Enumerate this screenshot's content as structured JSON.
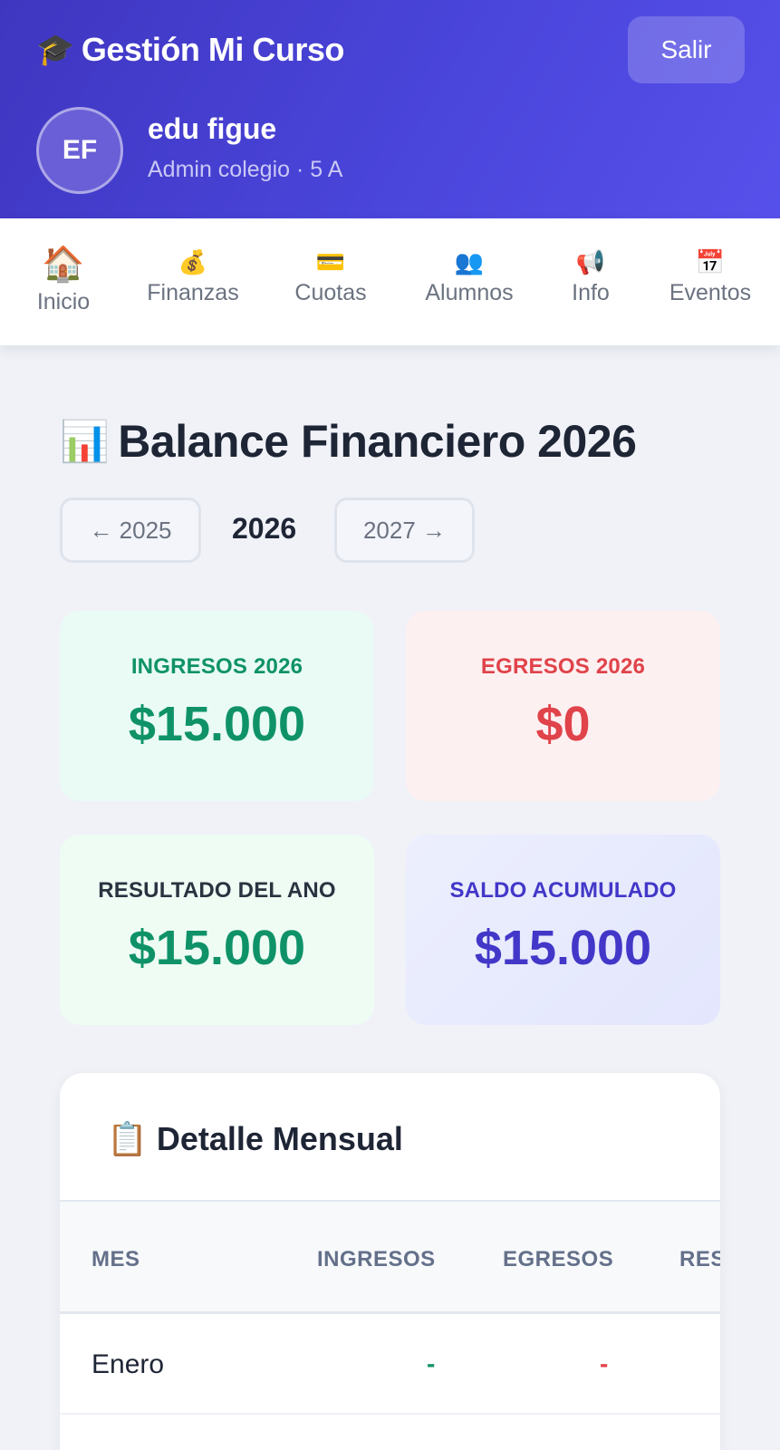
{
  "header": {
    "brand_icon": "graduation-cap-icon",
    "brand_icon_glyph": "🎓",
    "brand_title": "Gestión Mi Curso",
    "logout_label": "Salir",
    "user": {
      "initials": "EF",
      "name": "edu figue",
      "role": "Admin colegio · 5 A"
    }
  },
  "nav": {
    "items": [
      {
        "label": "Inicio",
        "icon": "house-icon",
        "glyph": "🏠",
        "active": true
      },
      {
        "label": "Finanzas",
        "icon": "money-bag-icon",
        "glyph": "💰",
        "active": false
      },
      {
        "label": "Cuotas",
        "icon": "credit-card-icon",
        "glyph": "💳",
        "active": false
      },
      {
        "label": "Alumnos",
        "icon": "people-icon",
        "glyph": "👥",
        "active": false
      },
      {
        "label": "Info",
        "icon": "megaphone-icon",
        "glyph": "📢",
        "active": false
      },
      {
        "label": "Eventos",
        "icon": "calendar-icon",
        "glyph": "📅",
        "active": false
      }
    ]
  },
  "page": {
    "title_glyph": "📊",
    "title": "Balance Financiero 2026",
    "year_prev": "← 2025",
    "year_current": "2026",
    "year_next": "2027 →"
  },
  "stats": {
    "ingresos": {
      "label": "INGRESOS 2026",
      "value": "$15.000"
    },
    "egresos": {
      "label": "EGRESOS 2026",
      "value": "$0"
    },
    "resultado": {
      "label": "RESULTADO DEL ANO",
      "value": "$15.000"
    },
    "saldo": {
      "label": "SALDO ACUMULADO",
      "value": "$15.000"
    }
  },
  "colors": {
    "header_gradient_start": "#3f36c0",
    "header_gradient_end": "#5750ea",
    "green_text": "#0f9268",
    "red_text": "#e0434a",
    "purple_text": "#4237c8",
    "ingresos_bg": "#e9fbf4",
    "egresos_bg": "#fdf0f1",
    "resultado_bg": "#eefcf4",
    "saldo_bg": "#e6e9fd"
  },
  "detalle": {
    "title_glyph": "📋",
    "title": "Detalle Mensual",
    "columns": [
      "MES",
      "INGRESOS",
      "EGRESOS",
      "RES"
    ],
    "rows": [
      {
        "mes": "Enero",
        "ingresos": "-",
        "egresos": "-"
      }
    ]
  }
}
